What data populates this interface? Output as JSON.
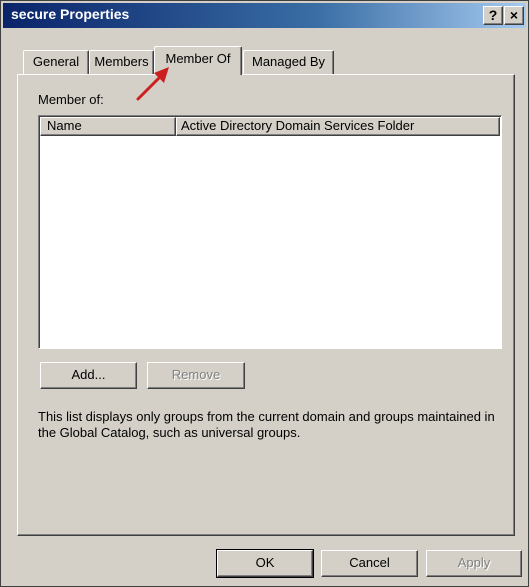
{
  "window": {
    "title": "secure Properties",
    "help_label": "?",
    "close_label": "×"
  },
  "tabs": [
    {
      "label": "General",
      "active": false
    },
    {
      "label": "Members",
      "active": false
    },
    {
      "label": "Member Of",
      "active": true
    },
    {
      "label": "Managed By",
      "active": false
    }
  ],
  "member_of": {
    "label": "Member of:",
    "columns": [
      "Name",
      "Active Directory Domain Services Folder"
    ],
    "rows": [],
    "add_label": "Add...",
    "remove_label": "Remove",
    "remove_enabled": false,
    "note": "This list displays only groups from the current domain and groups maintained in the Global Catalog, such as universal groups."
  },
  "footer": {
    "ok_label": "OK",
    "cancel_label": "Cancel",
    "apply_label": "Apply",
    "apply_enabled": false
  },
  "annotation": {
    "arrow_color": "#cc1f1f"
  }
}
